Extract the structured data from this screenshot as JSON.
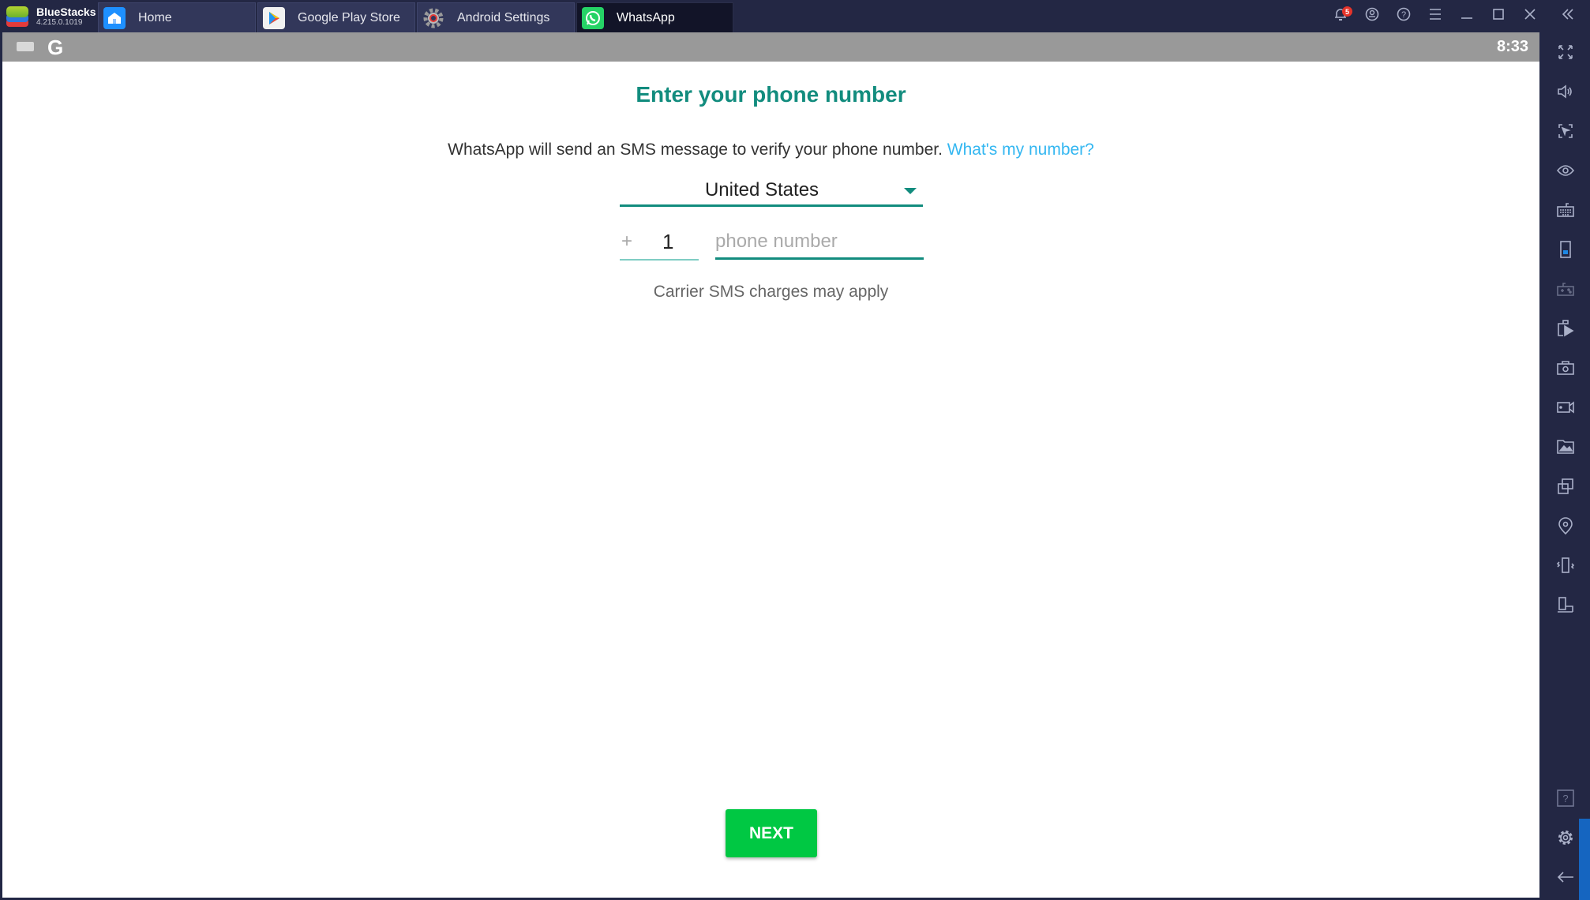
{
  "app": {
    "name": "BlueStacks",
    "version": "4.215.0.1019"
  },
  "tabs": [
    {
      "label": "Home",
      "icon": "home-icon",
      "active": false
    },
    {
      "label": "Google Play Store",
      "icon": "play-store-icon",
      "active": false
    },
    {
      "label": "Android Settings",
      "icon": "settings-gear-icon",
      "active": false
    },
    {
      "label": "WhatsApp",
      "icon": "whatsapp-icon",
      "active": true
    }
  ],
  "title_controls": {
    "notification_count": "5",
    "items": [
      "bell-icon",
      "account-icon",
      "help-icon",
      "menu-icon",
      "minimize-icon",
      "maximize-icon",
      "close-icon",
      "collapse-sidebar-icon"
    ]
  },
  "android_bar": {
    "time": "8:33",
    "g_label": "G"
  },
  "screen": {
    "heading": "Enter your phone number",
    "description": "WhatsApp will send an SMS message to verify your phone number.",
    "link": "What's my number?",
    "country": "United States",
    "plus": "+",
    "country_code": "1",
    "phone_placeholder": "phone number",
    "phone_value": "",
    "carrier_note": "Carrier SMS charges may apply",
    "next_label": "NEXT"
  },
  "sidebar": [
    "fullscreen-icon",
    "volume-icon",
    "pointer-lock-icon",
    "eye-icon",
    "keymap-keyboard-icon",
    "portrait-mode-icon",
    "gamepad-icon",
    "media-manager-icon",
    "screenshot-icon",
    "record-video-icon",
    "gallery-icon",
    "multi-instance-icon",
    "location-icon",
    "shake-icon",
    "rotate-icon",
    "help-box-icon",
    "settings-icon",
    "back-icon"
  ],
  "colors": {
    "accent": "#128c7e",
    "link": "#34b7f1",
    "button": "#00c843",
    "chrome": "#232744"
  }
}
